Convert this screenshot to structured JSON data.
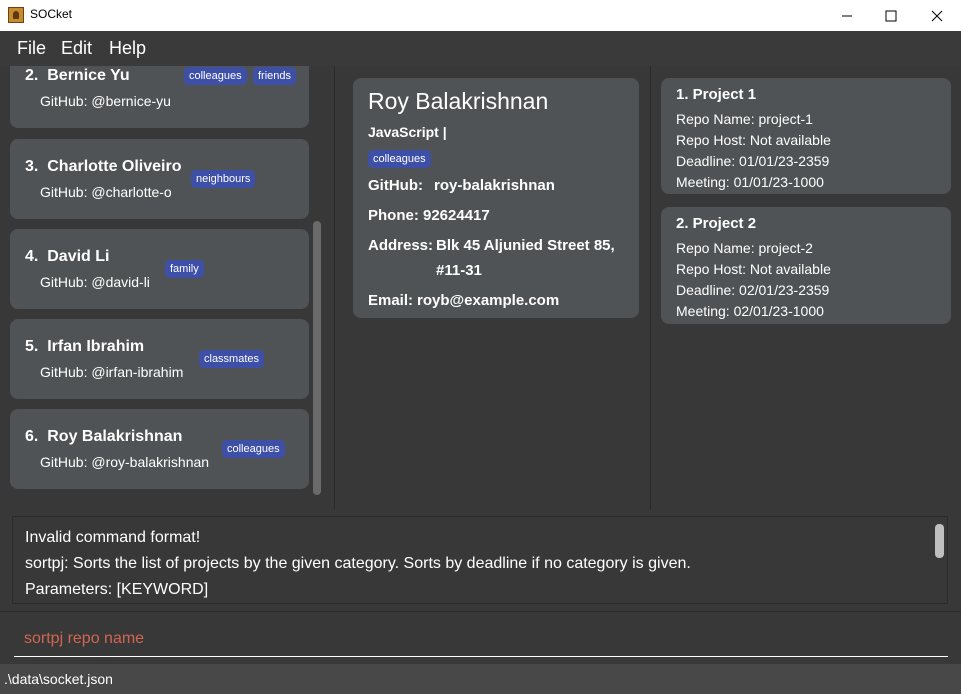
{
  "window": {
    "title": "SOCket"
  },
  "menu": {
    "items": [
      "File",
      "Edit",
      "Help"
    ]
  },
  "persons": [
    {
      "index": "2.",
      "name": "Bernice Yu",
      "github": "GitHub: @bernice-yu",
      "tags": [
        "colleagues",
        "friends"
      ]
    },
    {
      "index": "3.",
      "name": "Charlotte Oliveiro",
      "github": "GitHub: @charlotte-o",
      "tags": [
        "neighbours"
      ]
    },
    {
      "index": "4.",
      "name": "David Li",
      "github": "GitHub: @david-li",
      "tags": [
        "family"
      ]
    },
    {
      "index": "5.",
      "name": "Irfan Ibrahim",
      "github": "GitHub: @irfan-ibrahim",
      "tags": [
        "classmates"
      ]
    },
    {
      "index": "6.",
      "name": "Roy Balakrishnan",
      "github": "GitHub: @roy-balakrishnan",
      "tags": [
        "colleagues"
      ]
    }
  ],
  "detail": {
    "name": "Roy Balakrishnan",
    "languages": "JavaScript |",
    "tag": "colleagues",
    "github_label": "GitHub:",
    "github_value": "roy-balakrishnan",
    "phone_label": "Phone:",
    "phone_value": "92624417",
    "address_label": "Address:",
    "address_line1": "Blk 45 Aljunied Street 85,",
    "address_line2": "#11-31",
    "email_label": "Email:",
    "email_value": "royb@example.com"
  },
  "projects": [
    {
      "title": "1.  Project 1",
      "repo_name": "Repo Name: project-1",
      "repo_host": "Repo Host: Not available",
      "deadline": "Deadline: 01/01/23-2359",
      "meeting": "Meeting: 01/01/23-1000"
    },
    {
      "title": "2.  Project 2",
      "repo_name": "Repo Name: project-2",
      "repo_host": "Repo Host: Not available",
      "deadline": "Deadline: 02/01/23-2359",
      "meeting": "Meeting: 02/01/23-1000"
    }
  ],
  "result": {
    "line1": "Invalid command format!",
    "line2": "sortpj: Sorts the list of projects by the given category. Sorts by deadline if no category is given.",
    "line3": "Parameters: [KEYWORD]"
  },
  "command": {
    "value": "sortpj repo name"
  },
  "status": {
    "path": ".\\data\\socket.json"
  },
  "colors": {
    "tag": "#3e4fa8",
    "card": "#505355",
    "background": "#383838",
    "command_text": "#d06651"
  },
  "icons": {
    "app": "socket-app-icon",
    "minimize": "minimize-icon",
    "maximize": "maximize-icon",
    "close": "close-icon"
  }
}
